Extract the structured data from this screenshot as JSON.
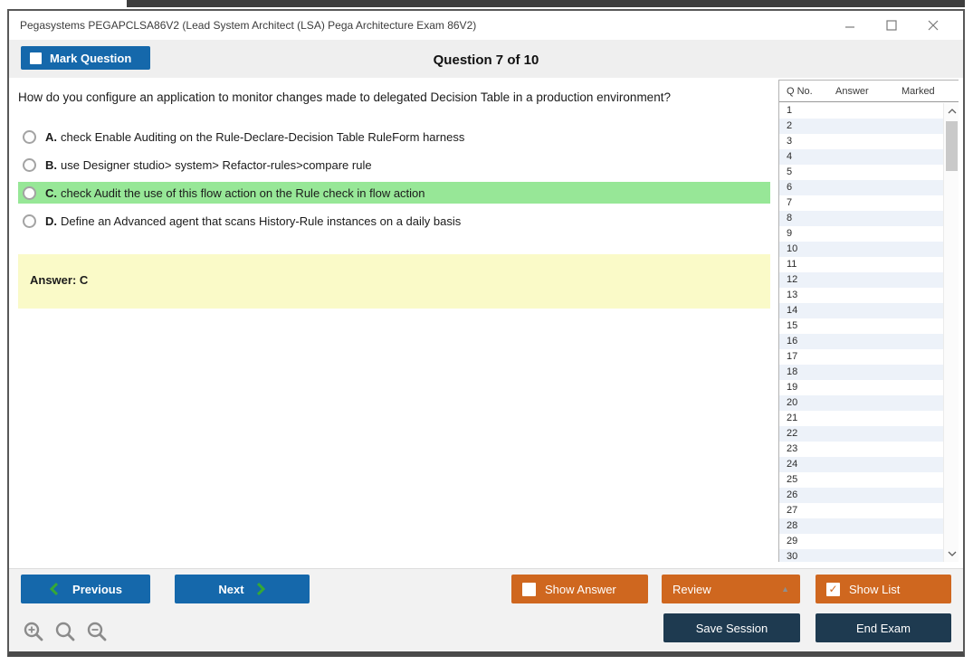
{
  "window": {
    "title": "Pegasystems PEGAPCLSA86V2 (Lead System Architect (LSA) Pega Architecture Exam 86V2)"
  },
  "header": {
    "mark_question": "Mark Question",
    "question_counter": "Question 7 of 10"
  },
  "question": {
    "text": "How do you configure an application to monitor changes made to delegated Decision Table in a production environment?",
    "options": [
      {
        "letter": "A.",
        "text": "check Enable Auditing on the Rule-Declare-Decision Table RuleForm harness",
        "highlighted": false
      },
      {
        "letter": "B.",
        "text": "use Designer studio> system> Refactor-rules>compare rule",
        "highlighted": false
      },
      {
        "letter": "C.",
        "text": "check Audit the use of this flow action on the Rule check in flow action",
        "highlighted": true
      },
      {
        "letter": "D.",
        "text": "Define an Advanced agent that scans History-Rule instances on a daily basis",
        "highlighted": false
      }
    ],
    "answer": "Answer: C"
  },
  "sidebar": {
    "columns": {
      "q": "Q No.",
      "answer": "Answer",
      "marked": "Marked"
    },
    "rows": [
      "1",
      "2",
      "3",
      "4",
      "5",
      "6",
      "7",
      "8",
      "9",
      "10",
      "11",
      "12",
      "13",
      "14",
      "15",
      "16",
      "17",
      "18",
      "19",
      "20",
      "21",
      "22",
      "23",
      "24",
      "25",
      "26",
      "27",
      "28",
      "29",
      "30"
    ]
  },
  "footer": {
    "previous": "Previous",
    "next": "Next",
    "show_answer": "Show Answer",
    "review": "Review",
    "show_list": "Show List",
    "save_session": "Save Session",
    "end_exam": "End Exam"
  },
  "colors": {
    "blue": "#1568ab",
    "orange": "#cf671f",
    "navy": "#1e3a50",
    "highlight_green": "#97e797",
    "answer_yellow": "#fafac8",
    "row_alt_blue": "#edf2f9",
    "chevron_green": "#35a835"
  }
}
